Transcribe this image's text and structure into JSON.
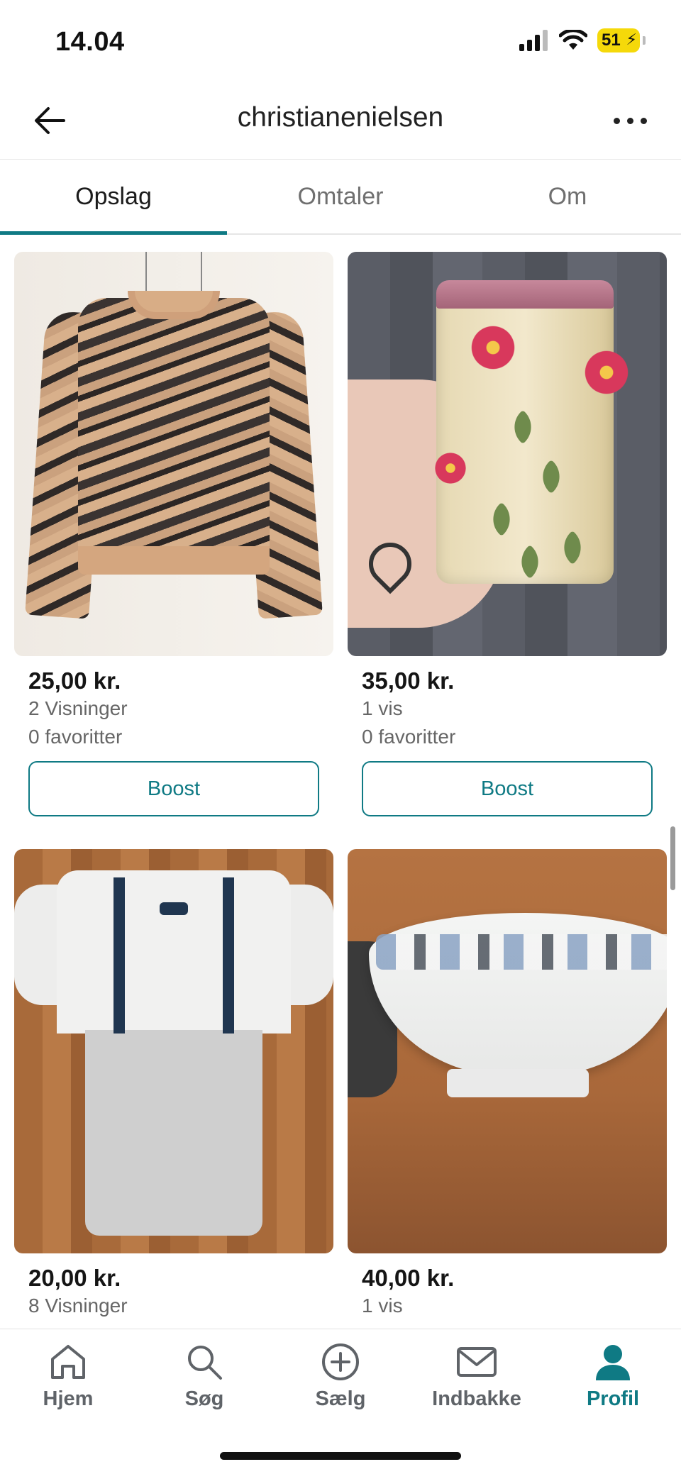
{
  "status_bar": {
    "time": "14.04",
    "battery": "51"
  },
  "header": {
    "title": "christianenielsen"
  },
  "tabs": [
    {
      "label": "Opslag",
      "active": true
    },
    {
      "label": "Omtaler",
      "active": false
    },
    {
      "label": "Om",
      "active": false
    }
  ],
  "listings": [
    {
      "price": "25,00 kr.",
      "views": "2 Visninger",
      "favorites": "0 favoritter",
      "boost_label": "Boost",
      "image": "zebra-sweater"
    },
    {
      "price": "35,00 kr.",
      "views": "1 vis",
      "favorites": "0 favoritter",
      "boost_label": "Boost",
      "image": "floral-tin"
    },
    {
      "price": "20,00 kr.",
      "views": "8 Visninger",
      "favorites": "",
      "boost_label": "",
      "image": "baby-romper"
    },
    {
      "price": "40,00 kr.",
      "views": "1 vis",
      "favorites": "",
      "boost_label": "",
      "image": "porcelain-bowl"
    }
  ],
  "bottom_nav": [
    {
      "label": "Hjem",
      "icon": "home-icon",
      "active": false
    },
    {
      "label": "Søg",
      "icon": "search-icon",
      "active": false
    },
    {
      "label": "Sælg",
      "icon": "plus-circle-icon",
      "active": false
    },
    {
      "label": "Indbakke",
      "icon": "mail-icon",
      "active": false
    },
    {
      "label": "Profil",
      "icon": "profile-icon",
      "active": true
    }
  ],
  "colors": {
    "accent": "#0f7a84",
    "text": "#111111",
    "muted": "#666666"
  }
}
